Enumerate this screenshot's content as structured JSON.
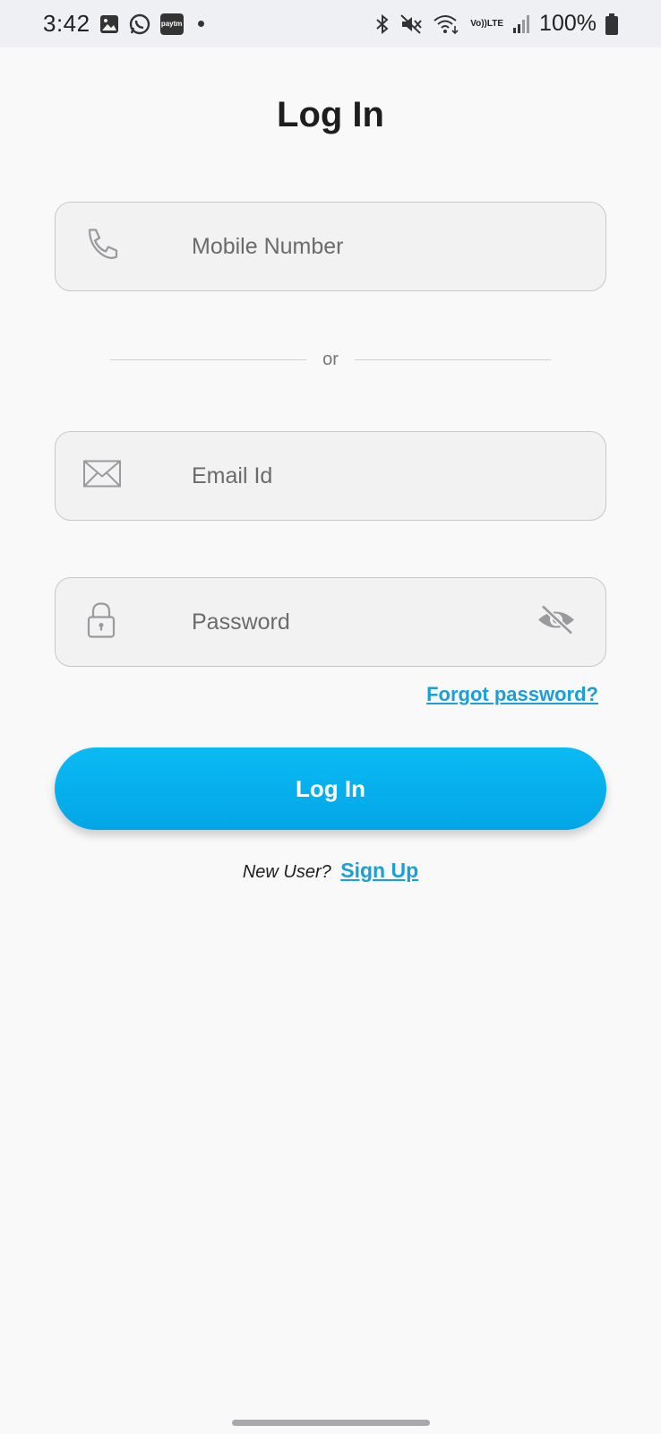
{
  "status_bar": {
    "time": "3:42",
    "paytm_label": "paytm",
    "volte_top": "Vo))",
    "volte_bottom": "LTE",
    "battery": "100%"
  },
  "title": "Log In",
  "mobile": {
    "placeholder": "Mobile Number",
    "icon": "phone-icon"
  },
  "divider_text": "or",
  "email": {
    "placeholder": "Email Id",
    "icon": "mail-icon"
  },
  "password": {
    "placeholder": "Password",
    "icon": "lock-icon",
    "toggle_icon": "eye-off-icon"
  },
  "forgot_password": "Forgot password?",
  "login_button": "Log In",
  "new_user": {
    "text": "New User?",
    "link": "Sign Up"
  },
  "colors": {
    "accent": "#02a6e6",
    "link": "#1a9fd6",
    "background": "#f9f9fa",
    "field": "#f2f2f3"
  }
}
